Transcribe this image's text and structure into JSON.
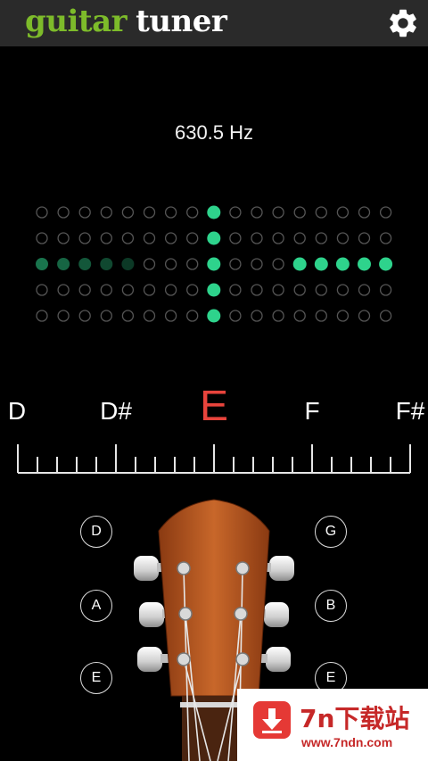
{
  "app": {
    "title_part1": "guitar",
    "title_part2": "tuner",
    "settings_icon": "gear-icon"
  },
  "frequency": "630.5 Hz",
  "notes": [
    "D",
    "D#",
    "E",
    "F",
    "F#"
  ],
  "active_note": "E",
  "meter": {
    "columns": 17,
    "rows": 5,
    "active_left_cols": 5,
    "active_right_cols": 5,
    "colors": {
      "bright": "#2ed38c",
      "dim": "#1f5a3d",
      "off": "#555555"
    }
  },
  "strings_left": [
    "D",
    "A",
    "E"
  ],
  "strings_right": [
    "G",
    "B",
    "E"
  ],
  "watermark": {
    "name": "7n下载站",
    "url": "www.7ndn.com"
  }
}
